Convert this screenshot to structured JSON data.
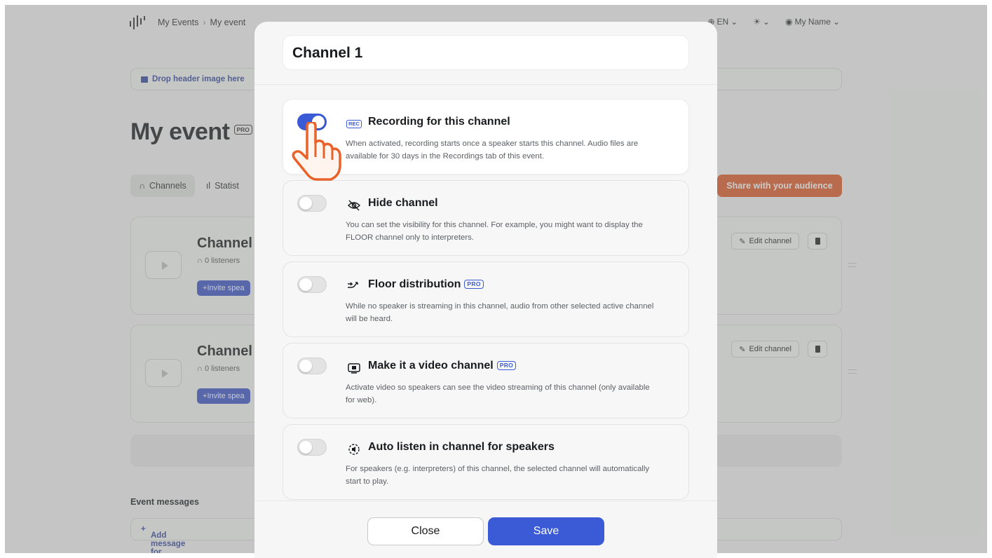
{
  "topbar": {
    "breadcrumb": [
      "My Events",
      "My event"
    ],
    "language": "EN",
    "user_name": "My Name"
  },
  "header_drop": {
    "label": "Drop header image here"
  },
  "event": {
    "title": "My event",
    "badge": "PRO"
  },
  "tabs": [
    {
      "label": "Channels",
      "icon": "headphones-icon",
      "active": true
    },
    {
      "label": "Statist",
      "icon": "stats-icon",
      "active": false
    }
  ],
  "share_button": "Share with your audience",
  "channels": [
    {
      "name": "Channel",
      "listeners": "0 listeners",
      "invite": "Invite spea",
      "edit": "Edit channel"
    },
    {
      "name": "Channel",
      "listeners": "0 listeners",
      "invite": "Invite spea",
      "edit": "Edit channel"
    }
  ],
  "event_messages": {
    "heading": "Event messages",
    "add_label": "Add message for listeners"
  },
  "modal": {
    "title": "Channel 1",
    "options": [
      {
        "title": "Recording for this channel",
        "icon": "rec-icon",
        "badge": "REC",
        "pro": "",
        "enabled": true,
        "desc": "When activated, recording starts once a speaker starts this channel. Audio files are available for 30 days in the Recordings tab of this event."
      },
      {
        "title": "Hide channel",
        "icon": "eye-off-icon",
        "pro": "",
        "enabled": false,
        "desc": "You can set the visibility for this channel. For example, you might want to display the FLOOR channel only to interpreters."
      },
      {
        "title": "Floor distribution",
        "icon": "merge-arrow-icon",
        "pro": "PRO",
        "enabled": false,
        "desc": "While no speaker is streaming in this channel, audio from other selected active channel will be heard."
      },
      {
        "title": "Make it a video channel",
        "icon": "video-icon",
        "pro": "PRO",
        "enabled": false,
        "desc": "Activate video so speakers can see the video streaming of this channel (only available for web)."
      },
      {
        "title": "Auto listen in channel for speakers",
        "icon": "auto-listen-icon",
        "pro": "",
        "enabled": false,
        "desc": "For speakers (e.g. interpreters) of this channel, the selected channel will automatically start to play."
      }
    ],
    "close_label": "Close",
    "save_label": "Save"
  },
  "colors": {
    "primary": "#3b5bd6",
    "accent": "#e05a28",
    "hand": "#e8622a"
  }
}
